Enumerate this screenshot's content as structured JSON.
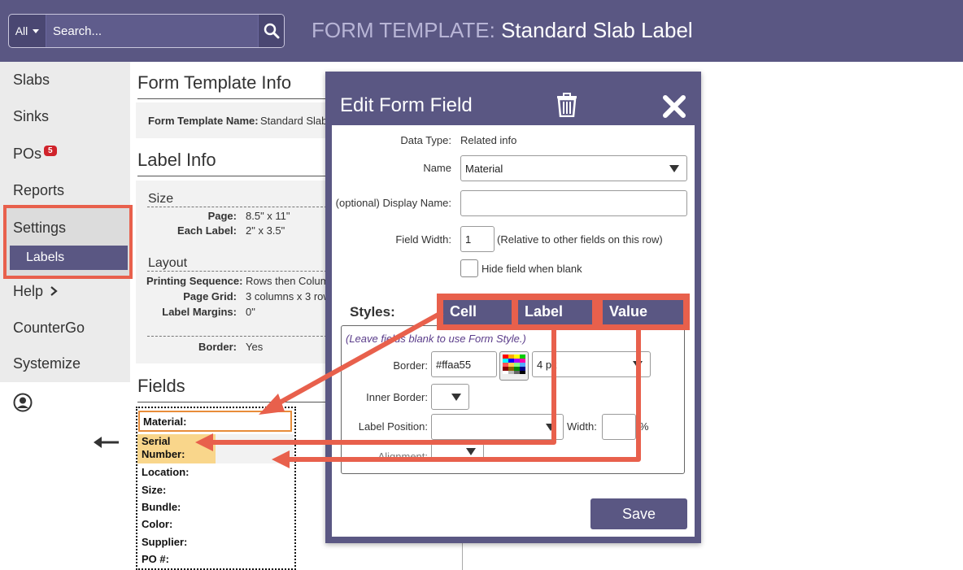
{
  "header": {
    "scope_label": "All",
    "search_placeholder": "Search...",
    "heading_prefix": "FORM TEMPLATE:",
    "heading_title": "Standard Slab Label"
  },
  "sidebar": {
    "items": [
      {
        "label": "Slabs"
      },
      {
        "label": "Sinks"
      },
      {
        "label": "POs",
        "badge": "5"
      },
      {
        "label": "Reports"
      },
      {
        "label": "Settings"
      },
      {
        "label": "Labels"
      },
      {
        "label": "Help"
      },
      {
        "label": "CounterGo"
      },
      {
        "label": "Systemize"
      }
    ]
  },
  "form_template_info": {
    "heading": "Form Template Info",
    "name_label": "Form Template Name:",
    "name_value": "Standard Slab"
  },
  "label_info": {
    "heading": "Label Info",
    "size_heading": "Size",
    "page_label": "Page:",
    "page_value": "8.5\" x 11\"",
    "each_label": "Each Label:",
    "each_value": "2\" x 3.5\"",
    "layout_heading": "Layout",
    "seq_label": "Printing Sequence:",
    "seq_value": "Rows then Colum",
    "grid_label": "Page Grid:",
    "grid_value": "3 columns x 3 row",
    "margins_label": "Label Margins:",
    "margins_value": "0\"",
    "border_label": "Border:",
    "border_value": "Yes"
  },
  "fields": {
    "heading": "Fields",
    "items": [
      "Material:",
      "Serial",
      "Number:",
      "Location:",
      "Size:",
      "Bundle:",
      "Color:",
      "Supplier:",
      "PO #:"
    ]
  },
  "modal": {
    "title": "Edit Form Field",
    "data_type_label": "Data Type:",
    "data_type_value": "Related info",
    "name_label": "Name",
    "name_value": "Material",
    "display_name_label": "(optional) Display Name:",
    "display_name_value": "",
    "field_width_label": "Field Width:",
    "field_width_value": "1",
    "field_width_note": "(Relative to other fields on this row)",
    "hide_label": "Hide field when blank",
    "styles_label": "Styles:",
    "tabs": [
      "Cell",
      "Label",
      "Value"
    ],
    "hint": "(Leave fields blank to use Form Style.)",
    "border_label": "Border:",
    "border_color": "#ffaa55",
    "border_width": "4 px",
    "inner_border_label": "Inner Border:",
    "label_position_label": "Label Position:",
    "width_label": "Width:",
    "width_unit": "%",
    "alignment_label": "Alignment:",
    "save_label": "Save"
  },
  "colors": {
    "header_bg": "#5a5783",
    "highlight": "#e8604c",
    "selected_field_border": "#e88d3a",
    "serial_highlight": "#f9d68b"
  }
}
